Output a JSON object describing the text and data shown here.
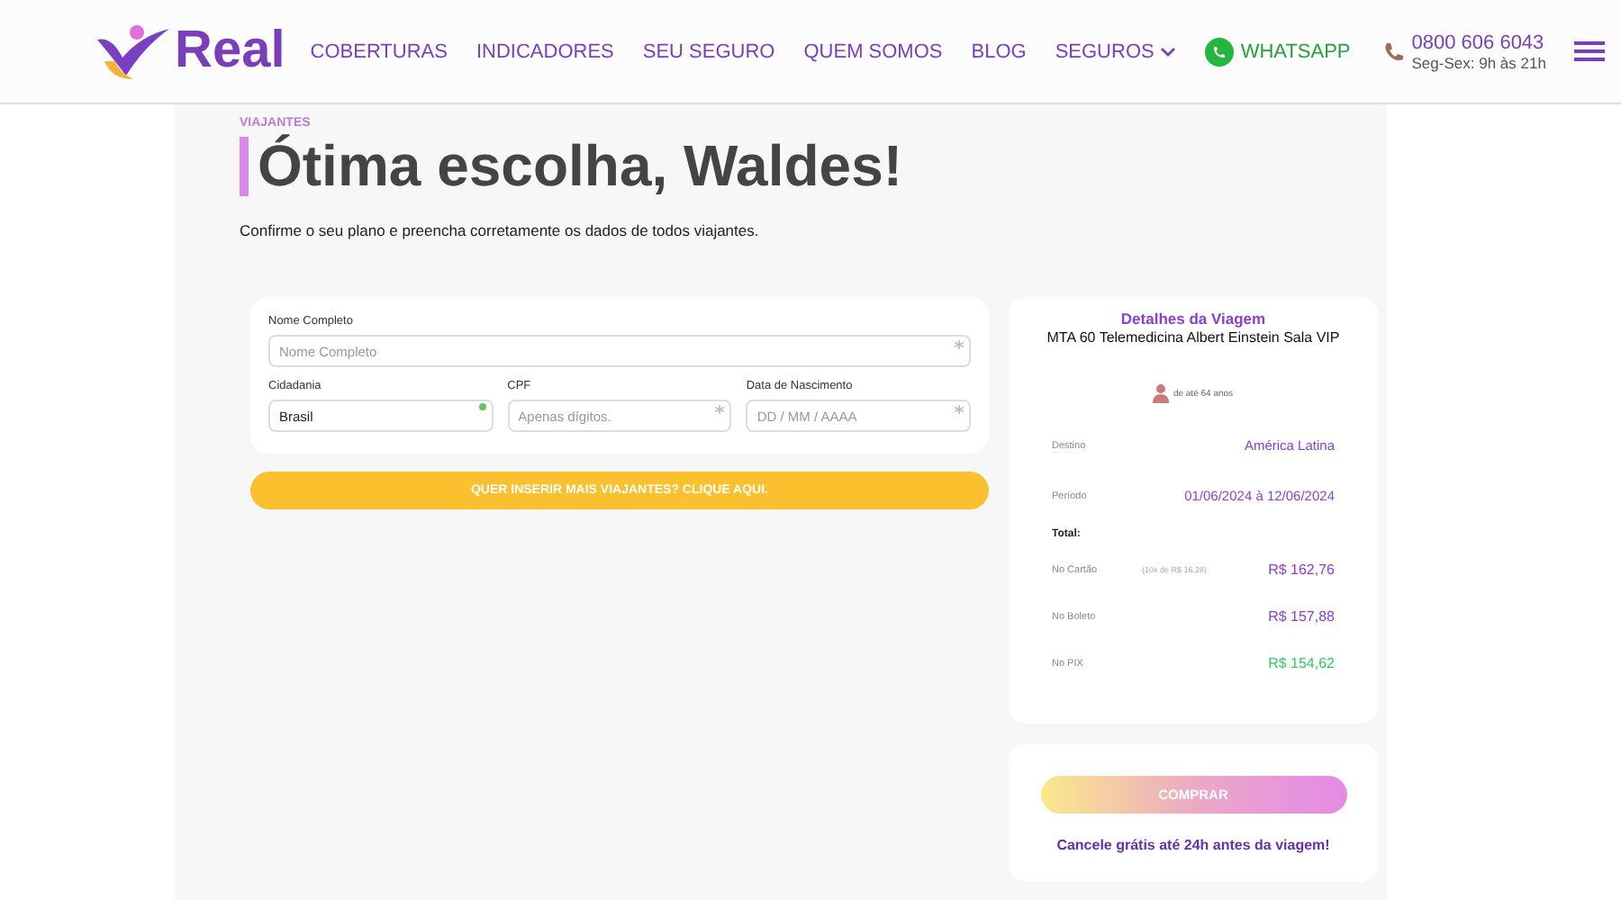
{
  "header": {
    "logo": "Real",
    "nav": [
      {
        "label": "COBERTURAS",
        "kind": "link"
      },
      {
        "label": "INDICADORES",
        "kind": "link"
      },
      {
        "label": "SEU SEGURO",
        "kind": "link"
      },
      {
        "label": "QUEM SOMOS",
        "kind": "link"
      },
      {
        "label": "BLOG",
        "kind": "link"
      },
      {
        "label": "SEGUROS",
        "kind": "dropdown"
      }
    ],
    "whatsapp": "WHATSAPP",
    "phone": "0800 606 6043",
    "hours": "Seg-Sex: 9h às 21h"
  },
  "intro": {
    "eyebrow": "VIAJANTES",
    "title": "Ótima escolha, Waldes!",
    "subtitle": "Confirme o seu plano e preencha corretamente os dados de todos viajantes."
  },
  "form": {
    "fields": [
      {
        "label": "Nome Completo",
        "placeholder": "Nome Completo",
        "valid": false
      },
      {
        "label": "Cidadania",
        "value": "Brasil",
        "valid": true
      },
      {
        "label": "CPF",
        "placeholder": "Apenas dígitos.",
        "valid": false
      },
      {
        "label": "Data de Nascimento",
        "placeholder": "DD / MM / AAAA",
        "valid": false
      }
    ],
    "add_button": "QUER INSERIR MAIS VIAJANTES? CLIQUE AQUI."
  },
  "trip": {
    "title": "Detalhes da Viagem",
    "plan": "MTA 60 Telemedicina Albert Einstein Sala VIP",
    "traveler": "de até 64 anos",
    "details": [
      {
        "label": "Destino",
        "value": "América Latina"
      },
      {
        "label": "Período",
        "value": "01/06/2024 à 12/06/2024"
      }
    ],
    "total_label": "Total:",
    "prices": [
      {
        "label": "No Cartão",
        "note": "(10x de R$ 16,28)",
        "value": "R$ 162,76",
        "color": "#8a3fd1"
      },
      {
        "label": "No Boleto",
        "value": "R$ 157,88",
        "color": "#8a3fd1"
      },
      {
        "label": "No PIX",
        "value": "R$ 154,62",
        "color": "#2ecc5a"
      }
    ]
  },
  "buy": {
    "button": "COMPRAR",
    "note": "Cancele grátis até 24h antes da viagem!"
  }
}
